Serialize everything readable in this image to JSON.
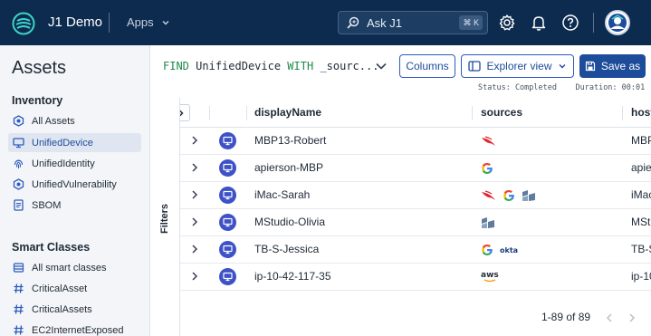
{
  "topbar": {
    "app_name": "J1 Demo",
    "apps_label": "Apps",
    "ask_label": "Ask J1",
    "ask_shortcut": "⌘ K",
    "icons": [
      "settings-icon",
      "bell-icon",
      "help-icon"
    ]
  },
  "sidebar": {
    "title": "Assets",
    "inventory_heading": "Inventory",
    "inventory_items": [
      {
        "label": "All Assets",
        "icon": "hexagon-icon"
      },
      {
        "label": "UnifiedDevice",
        "icon": "monitor-icon",
        "active": true
      },
      {
        "label": "UnifiedIdentity",
        "icon": "fingerprint-icon"
      },
      {
        "label": "UnifiedVulnerability",
        "icon": "hexagon-icon"
      },
      {
        "label": "SBOM",
        "icon": "document-icon"
      }
    ],
    "smart_heading": "Smart Classes",
    "smart_items": [
      {
        "label": "All smart classes",
        "icon": "list-icon"
      },
      {
        "label": "CriticalAsset",
        "icon": "hash-icon"
      },
      {
        "label": "CriticalAssets",
        "icon": "hash-icon"
      },
      {
        "label": "EC2InternetExposed",
        "icon": "hash-icon"
      }
    ]
  },
  "query": {
    "find": "FIND",
    "entity": "UnifiedDevice",
    "with": "WITH",
    "rest": "_sourc..."
  },
  "toolbar": {
    "columns_label": "Columns",
    "explorer_label": "Explorer view",
    "save_label": "Save as"
  },
  "status": {
    "text": "Status: Completed",
    "duration": "Duration: 00:01"
  },
  "filters_label": "Filters",
  "table": {
    "columns": [
      "displayName",
      "sources",
      "host"
    ],
    "rows": [
      {
        "name": "MBP13-Robert",
        "sources": [
          "crowdstrike"
        ],
        "host": "MBP"
      },
      {
        "name": "apierson-MBP",
        "sources": [
          "google"
        ],
        "host": "apie"
      },
      {
        "name": "iMac-Sarah",
        "sources": [
          "crowdstrike",
          "google",
          "jamf"
        ],
        "host": "iMac"
      },
      {
        "name": "MStudio-Olivia",
        "sources": [
          "jamf"
        ],
        "host": "MSt"
      },
      {
        "name": "TB-S-Jessica",
        "sources": [
          "google",
          "okta"
        ],
        "host": "TB-S"
      },
      {
        "name": "ip-10-42-117-35",
        "sources": [
          "aws"
        ],
        "host": "ip-10"
      }
    ]
  },
  "source_labels": {
    "okta": "okta",
    "aws": "aws"
  },
  "pagination": {
    "text": "1-89 of 89"
  },
  "colors": {
    "navy": "#0d2b4f",
    "primary": "#1d4c9a",
    "entity": "#3e52c7",
    "query_keyword": "#1f8a4a"
  }
}
